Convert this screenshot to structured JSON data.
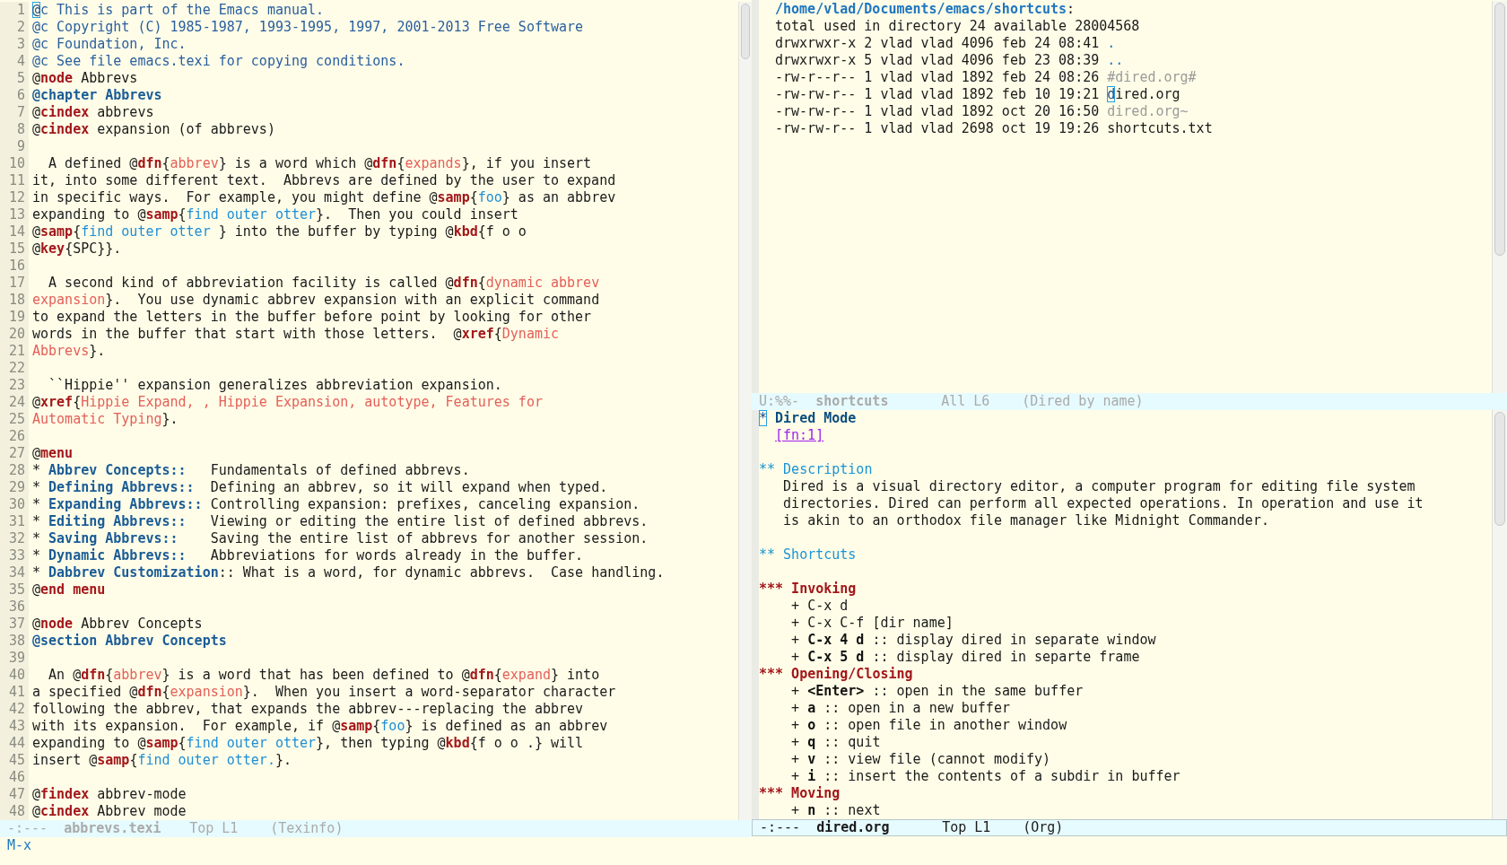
{
  "left_window": {
    "lines": [
      {
        "n": "1",
        "segments": [
          {
            "text": "@",
            "kind": "cursor"
          },
          {
            "text": "c This is part of the Emacs manual.",
            "kind": "comment"
          }
        ]
      },
      {
        "n": "2",
        "segments": [
          {
            "text": "@c Copyright (C) 1985-1987, 1993-1995, 1997, 2001-2013 Free Software",
            "kind": "comment"
          }
        ]
      },
      {
        "n": "3",
        "segments": [
          {
            "text": "@c Foundation, Inc.",
            "kind": "comment"
          }
        ]
      },
      {
        "n": "4",
        "segments": [
          {
            "text": "@c See file emacs.texi for copying conditions.",
            "kind": "comment"
          }
        ]
      },
      {
        "n": "5",
        "segments": [
          {
            "text": "@",
            "kind": "plain"
          },
          {
            "text": "node",
            "kind": "keyword"
          },
          {
            "text": " Abbrevs",
            "kind": "plain"
          }
        ]
      },
      {
        "n": "6",
        "segments": [
          {
            "text": "@chapter Abbrevs",
            "kind": "heading"
          }
        ]
      },
      {
        "n": "7",
        "segments": [
          {
            "text": "@",
            "kind": "plain"
          },
          {
            "text": "cindex",
            "kind": "keyword"
          },
          {
            "text": " abbrevs",
            "kind": "plain"
          }
        ]
      },
      {
        "n": "8",
        "segments": [
          {
            "text": "@",
            "kind": "plain"
          },
          {
            "text": "cindex",
            "kind": "keyword"
          },
          {
            "text": " expansion (of abbrevs)",
            "kind": "plain"
          }
        ]
      },
      {
        "n": "9"
      },
      {
        "n": "10",
        "segments": [
          {
            "text": "  A defined @",
            "kind": "plain"
          },
          {
            "text": "dfn",
            "kind": "keyword"
          },
          {
            "text": "{",
            "kind": "plain"
          },
          {
            "text": "abbrev",
            "kind": "dfn"
          },
          {
            "text": "} is a word which @",
            "kind": "plain"
          },
          {
            "text": "dfn",
            "kind": "keyword"
          },
          {
            "text": "{",
            "kind": "plain"
          },
          {
            "text": "expands",
            "kind": "dfn"
          },
          {
            "text": "}, if you insert",
            "kind": "plain"
          }
        ]
      },
      {
        "n": "11",
        "segments": [
          {
            "text": "it, into some different text.  Abbrevs are defined by the user to expand",
            "kind": "plain"
          }
        ]
      },
      {
        "n": "12",
        "segments": [
          {
            "text": "in specific ways.  For example, you might define @",
            "kind": "plain"
          },
          {
            "text": "samp",
            "kind": "keyword"
          },
          {
            "text": "{",
            "kind": "plain"
          },
          {
            "text": "foo",
            "kind": "samp"
          },
          {
            "text": "} as an abbrev",
            "kind": "plain"
          }
        ]
      },
      {
        "n": "13",
        "segments": [
          {
            "text": "expanding to @",
            "kind": "plain"
          },
          {
            "text": "samp",
            "kind": "keyword"
          },
          {
            "text": "{",
            "kind": "plain"
          },
          {
            "text": "find outer otter",
            "kind": "samp"
          },
          {
            "text": "}.  Then you could insert",
            "kind": "plain"
          }
        ]
      },
      {
        "n": "14",
        "segments": [
          {
            "text": "@",
            "kind": "plain"
          },
          {
            "text": "samp",
            "kind": "keyword"
          },
          {
            "text": "{",
            "kind": "plain"
          },
          {
            "text": "find outer otter",
            "kind": "samp"
          },
          {
            "text": " } into the buffer by typing @",
            "kind": "plain"
          },
          {
            "text": "kbd",
            "kind": "keyword"
          },
          {
            "text": "{f o o",
            "kind": "plain"
          }
        ]
      },
      {
        "n": "15",
        "segments": [
          {
            "text": "@",
            "kind": "plain"
          },
          {
            "text": "key",
            "kind": "keyword"
          },
          {
            "text": "{SPC}}.",
            "kind": "plain"
          }
        ]
      },
      {
        "n": "16"
      },
      {
        "n": "17",
        "segments": [
          {
            "text": "  A second kind of abbreviation facility is called @",
            "kind": "plain"
          },
          {
            "text": "dfn",
            "kind": "keyword"
          },
          {
            "text": "{",
            "kind": "plain"
          },
          {
            "text": "dynamic abbrev",
            "kind": "dfn"
          }
        ]
      },
      {
        "n": "18",
        "segments": [
          {
            "text": "expansion",
            "kind": "dfn"
          },
          {
            "text": "}.  You use dynamic abbrev expansion with an explicit command",
            "kind": "plain"
          }
        ]
      },
      {
        "n": "19",
        "segments": [
          {
            "text": "to expand the letters in the buffer before point by looking for other",
            "kind": "plain"
          }
        ]
      },
      {
        "n": "20",
        "segments": [
          {
            "text": "words in the buffer that start with those letters.  @",
            "kind": "plain"
          },
          {
            "text": "xref",
            "kind": "keyword"
          },
          {
            "text": "{",
            "kind": "plain"
          },
          {
            "text": "Dynamic",
            "kind": "dfn"
          }
        ]
      },
      {
        "n": "21",
        "segments": [
          {
            "text": "Abbrevs",
            "kind": "dfn"
          },
          {
            "text": "}.",
            "kind": "plain"
          }
        ]
      },
      {
        "n": "22"
      },
      {
        "n": "23",
        "segments": [
          {
            "text": "  ``Hippie'' expansion generalizes abbreviation expansion.",
            "kind": "plain"
          }
        ]
      },
      {
        "n": "24",
        "segments": [
          {
            "text": "@",
            "kind": "plain"
          },
          {
            "text": "xref",
            "kind": "keyword"
          },
          {
            "text": "{",
            "kind": "plain"
          },
          {
            "text": "Hippie Expand, , Hippie Expansion, autotype, Features for",
            "kind": "dfn"
          }
        ]
      },
      {
        "n": "25",
        "segments": [
          {
            "text": "Automatic Typing",
            "kind": "dfn"
          },
          {
            "text": "}.",
            "kind": "plain"
          }
        ]
      },
      {
        "n": "26"
      },
      {
        "n": "27",
        "segments": [
          {
            "text": "@",
            "kind": "plain"
          },
          {
            "text": "menu",
            "kind": "keyword"
          }
        ]
      },
      {
        "n": "28",
        "segments": [
          {
            "text": "* ",
            "kind": "plain"
          },
          {
            "text": "Abbrev Concepts::",
            "kind": "heading"
          },
          {
            "text": "   Fundamentals of defined abbrevs.",
            "kind": "plain"
          }
        ]
      },
      {
        "n": "29",
        "segments": [
          {
            "text": "* ",
            "kind": "plain"
          },
          {
            "text": "Defining Abbrevs::",
            "kind": "heading"
          },
          {
            "text": "  Defining an abbrev, so it will expand when typed.",
            "kind": "plain"
          }
        ]
      },
      {
        "n": "30",
        "segments": [
          {
            "text": "* ",
            "kind": "plain"
          },
          {
            "text": "Expanding Abbrevs::",
            "kind": "heading"
          },
          {
            "text": " Controlling expansion: prefixes, canceling expansion.",
            "kind": "plain"
          }
        ]
      },
      {
        "n": "31",
        "segments": [
          {
            "text": "* ",
            "kind": "plain"
          },
          {
            "text": "Editing Abbrevs::",
            "kind": "heading"
          },
          {
            "text": "   Viewing or editing the entire list of defined abbrevs.",
            "kind": "plain"
          }
        ]
      },
      {
        "n": "32",
        "segments": [
          {
            "text": "* ",
            "kind": "plain"
          },
          {
            "text": "Saving Abbrevs::",
            "kind": "heading"
          },
          {
            "text": "    Saving the entire list of abbrevs for another session.",
            "kind": "plain"
          }
        ]
      },
      {
        "n": "33",
        "segments": [
          {
            "text": "* ",
            "kind": "plain"
          },
          {
            "text": "Dynamic Abbrevs::",
            "kind": "heading"
          },
          {
            "text": "   Abbreviations for words already in the buffer.",
            "kind": "plain"
          }
        ]
      },
      {
        "n": "34",
        "segments": [
          {
            "text": "* ",
            "kind": "plain"
          },
          {
            "text": "Dabbrev Customization",
            "kind": "heading"
          },
          {
            "text": ":: What is a word, for dynamic abbrevs.  Case handling.",
            "kind": "plain"
          }
        ]
      },
      {
        "n": "35",
        "segments": [
          {
            "text": "@",
            "kind": "plain"
          },
          {
            "text": "end menu",
            "kind": "keyword"
          }
        ]
      },
      {
        "n": "36"
      },
      {
        "n": "37",
        "segments": [
          {
            "text": "@",
            "kind": "plain"
          },
          {
            "text": "node",
            "kind": "keyword"
          },
          {
            "text": " Abbrev Concepts",
            "kind": "plain"
          }
        ]
      },
      {
        "n": "38",
        "segments": [
          {
            "text": "@section Abbrev Concepts",
            "kind": "heading"
          }
        ]
      },
      {
        "n": "39"
      },
      {
        "n": "40",
        "segments": [
          {
            "text": "  An @",
            "kind": "plain"
          },
          {
            "text": "dfn",
            "kind": "keyword"
          },
          {
            "text": "{",
            "kind": "plain"
          },
          {
            "text": "abbrev",
            "kind": "dfn"
          },
          {
            "text": "} is a word that has been defined to @",
            "kind": "plain"
          },
          {
            "text": "dfn",
            "kind": "keyword"
          },
          {
            "text": "{",
            "kind": "plain"
          },
          {
            "text": "expand",
            "kind": "dfn"
          },
          {
            "text": "} into",
            "kind": "plain"
          }
        ]
      },
      {
        "n": "41",
        "segments": [
          {
            "text": "a specified @",
            "kind": "plain"
          },
          {
            "text": "dfn",
            "kind": "keyword"
          },
          {
            "text": "{",
            "kind": "plain"
          },
          {
            "text": "expansion",
            "kind": "dfn"
          },
          {
            "text": "}.  When you insert a word-separator character",
            "kind": "plain"
          }
        ]
      },
      {
        "n": "42",
        "segments": [
          {
            "text": "following the abbrev, that expands the abbrev---replacing the abbrev",
            "kind": "plain"
          }
        ]
      },
      {
        "n": "43",
        "segments": [
          {
            "text": "with its expansion.  For example, if @",
            "kind": "plain"
          },
          {
            "text": "samp",
            "kind": "keyword"
          },
          {
            "text": "{",
            "kind": "plain"
          },
          {
            "text": "foo",
            "kind": "samp"
          },
          {
            "text": "} is defined as an abbrev",
            "kind": "plain"
          }
        ]
      },
      {
        "n": "44",
        "segments": [
          {
            "text": "expanding to @",
            "kind": "plain"
          },
          {
            "text": "samp",
            "kind": "keyword"
          },
          {
            "text": "{",
            "kind": "plain"
          },
          {
            "text": "find outer otter",
            "kind": "samp"
          },
          {
            "text": "}, then typing @",
            "kind": "plain"
          },
          {
            "text": "kbd",
            "kind": "keyword"
          },
          {
            "text": "{f o o .} will",
            "kind": "plain"
          }
        ]
      },
      {
        "n": "45",
        "segments": [
          {
            "text": "insert @",
            "kind": "plain"
          },
          {
            "text": "samp",
            "kind": "keyword"
          },
          {
            "text": "{",
            "kind": "plain"
          },
          {
            "text": "find outer otter.",
            "kind": "samp"
          },
          {
            "text": "}.",
            "kind": "plain"
          }
        ]
      },
      {
        "n": "46"
      },
      {
        "n": "47",
        "segments": [
          {
            "text": "@",
            "kind": "plain"
          },
          {
            "text": "findex",
            "kind": "keyword"
          },
          {
            "text": " abbrev-mode",
            "kind": "plain"
          }
        ]
      },
      {
        "n": "48",
        "segments": [
          {
            "text": "@",
            "kind": "plain"
          },
          {
            "text": "cindex",
            "kind": "keyword"
          },
          {
            "text": " Abbrev mode",
            "kind": "plain"
          }
        ]
      }
    ],
    "mode_line": {
      "active": false,
      "status": "-:---",
      "buffer": "abbrevs.texi",
      "position": "Top L1",
      "mode": "(Texinfo)"
    }
  },
  "right_top_window": {
    "lines": [
      {
        "segments": [
          {
            "text": "/home/vlad/Documents/emacs/shortcuts",
            "kind": "dirpath"
          },
          {
            "text": ":",
            "kind": "plain"
          }
        ]
      },
      {
        "segments": [
          {
            "text": "total used in directory 24 available 28004568",
            "kind": "plain"
          }
        ]
      },
      {
        "segments": [
          {
            "text": "drwxrwxr-x 2 vlad vlad 4096 feb 24 08:41 ",
            "kind": "plain"
          },
          {
            "text": ".",
            "kind": "dir"
          }
        ]
      },
      {
        "segments": [
          {
            "text": "drwxrwxr-x 5 vlad vlad 4096 feb 23 08:39 ",
            "kind": "plain"
          },
          {
            "text": "..",
            "kind": "dir"
          }
        ]
      },
      {
        "segments": [
          {
            "text": "-rw-r--r-- 1 vlad vlad 1892 feb 24 08:26 ",
            "kind": "plain"
          },
          {
            "text": "#dired.org#",
            "kind": "dim"
          }
        ]
      },
      {
        "segments": [
          {
            "text": "-rw-rw-r-- 1 vlad vlad 1892 feb 10 19:21 ",
            "kind": "plain"
          },
          {
            "text": "d",
            "kind": "cursor"
          },
          {
            "text": "ired.org",
            "kind": "plain"
          }
        ]
      },
      {
        "segments": [
          {
            "text": "-rw-rw-r-- 1 vlad vlad 1892 oct 20 16:50 ",
            "kind": "plain"
          },
          {
            "text": "dired.org~",
            "kind": "dim"
          }
        ]
      },
      {
        "segments": [
          {
            "text": "-rw-rw-r-- 1 vlad vlad 2698 oct 19 19:26 shortcuts.txt",
            "kind": "plain"
          }
        ]
      }
    ],
    "mode_line": {
      "active": false,
      "status": "U:%%-",
      "buffer": "shortcuts",
      "position": "All L6",
      "mode": "(Dired by name)"
    }
  },
  "right_bottom_window": {
    "lines": [
      {
        "segments": [
          {
            "text": "*",
            "kind": "cursor"
          },
          {
            "text": " Dired Mode",
            "kind": "org1"
          }
        ]
      },
      {
        "segments": [
          {
            "text": "[fn:1]",
            "kind": "link"
          }
        ]
      },
      {
        "kind": "blank"
      },
      {
        "segments": [
          {
            "text": "** Description",
            "kind": "org2"
          }
        ]
      },
      {
        "segments": [
          {
            "text": "   Dired is a visual directory editor, a computer program for editing file system",
            "kind": "plain"
          }
        ]
      },
      {
        "segments": [
          {
            "text": "   directories. Dired can perform all expected operations. In operation and use it",
            "kind": "plain"
          }
        ]
      },
      {
        "segments": [
          {
            "text": "   is akin to an orthodox file manager like Midnight Commander.",
            "kind": "plain"
          }
        ]
      },
      {
        "kind": "blank"
      },
      {
        "segments": [
          {
            "text": "** Shortcuts",
            "kind": "org2"
          }
        ]
      },
      {
        "kind": "blank"
      },
      {
        "segments": [
          {
            "text": "*** Invoking",
            "kind": "org3"
          }
        ]
      },
      {
        "segments": [
          {
            "text": "    + C-x d",
            "kind": "plain"
          }
        ]
      },
      {
        "segments": [
          {
            "text": "    + C-x C-f [dir name]",
            "kind": "plain"
          }
        ]
      },
      {
        "segments": [
          {
            "text": "    + ",
            "kind": "plain"
          },
          {
            "text": "C-x 4 d",
            "kind": "bold"
          },
          {
            "text": " :: display dired in separate window",
            "kind": "plain"
          }
        ]
      },
      {
        "segments": [
          {
            "text": "    + ",
            "kind": "plain"
          },
          {
            "text": "C-x 5 d",
            "kind": "bold"
          },
          {
            "text": " :: display dired in separte frame",
            "kind": "plain"
          }
        ]
      },
      {
        "segments": [
          {
            "text": "*** Opening/Closing",
            "kind": "org3"
          }
        ]
      },
      {
        "segments": [
          {
            "text": "    + ",
            "kind": "plain"
          },
          {
            "text": "<Enter>",
            "kind": "bold"
          },
          {
            "text": " :: open in the same buffer",
            "kind": "plain"
          }
        ]
      },
      {
        "segments": [
          {
            "text": "    + ",
            "kind": "plain"
          },
          {
            "text": "a",
            "kind": "bold"
          },
          {
            "text": " :: open in a new buffer",
            "kind": "plain"
          }
        ]
      },
      {
        "segments": [
          {
            "text": "    + ",
            "kind": "plain"
          },
          {
            "text": "o",
            "kind": "bold"
          },
          {
            "text": " :: open file in another window",
            "kind": "plain"
          }
        ]
      },
      {
        "segments": [
          {
            "text": "    + ",
            "kind": "plain"
          },
          {
            "text": "q",
            "kind": "bold"
          },
          {
            "text": " :: quit",
            "kind": "plain"
          }
        ]
      },
      {
        "segments": [
          {
            "text": "    + ",
            "kind": "plain"
          },
          {
            "text": "v",
            "kind": "bold"
          },
          {
            "text": " :: view file (cannot modify)",
            "kind": "plain"
          }
        ]
      },
      {
        "segments": [
          {
            "text": "    + ",
            "kind": "plain"
          },
          {
            "text": "i",
            "kind": "bold"
          },
          {
            "text": " :: insert the contents of a subdir in buffer",
            "kind": "plain"
          }
        ]
      },
      {
        "segments": [
          {
            "text": "*** Moving",
            "kind": "org3"
          }
        ]
      },
      {
        "segments": [
          {
            "text": "    + ",
            "kind": "plain"
          },
          {
            "text": "n",
            "kind": "bold"
          },
          {
            "text": " :: next",
            "kind": "plain"
          }
        ]
      }
    ],
    "mode_line": {
      "active": true,
      "status": "-:---",
      "buffer": "dired.org",
      "position": "Top L1",
      "mode": "(Org)"
    }
  },
  "minibuffer": {
    "text": "M-x"
  }
}
